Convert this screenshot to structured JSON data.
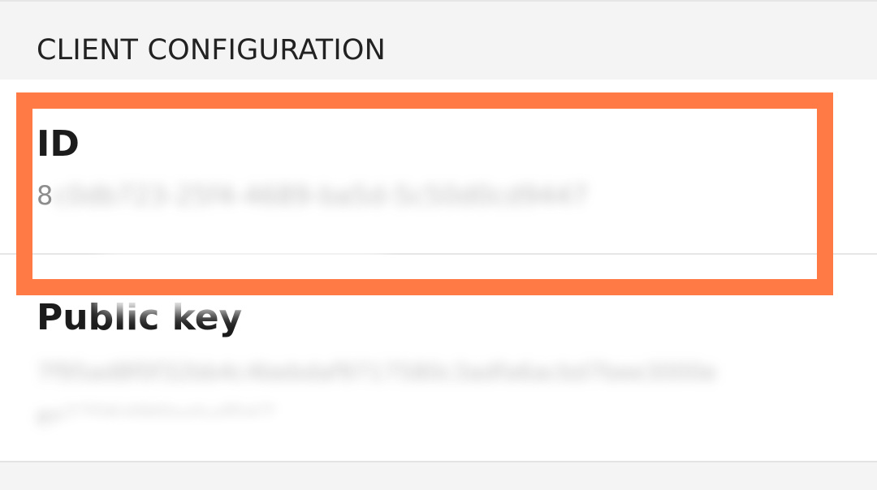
{
  "section": {
    "title": "CLIENT CONFIGURATION"
  },
  "id_row": {
    "label": "ID",
    "value_prefix": "8",
    "value_redacted": "c0db723-25f4-4689-ba5d-5c50d0cd9447"
  },
  "public_key_row": {
    "label": "Public key",
    "value_line1": "7f95ad8f0f32bb4c4bebdaf9717580c3adfa6acbd7bee3000e",
    "value_line2": "ea2706486bebaf047"
  },
  "highlight": {
    "color": "#ff7a45"
  }
}
